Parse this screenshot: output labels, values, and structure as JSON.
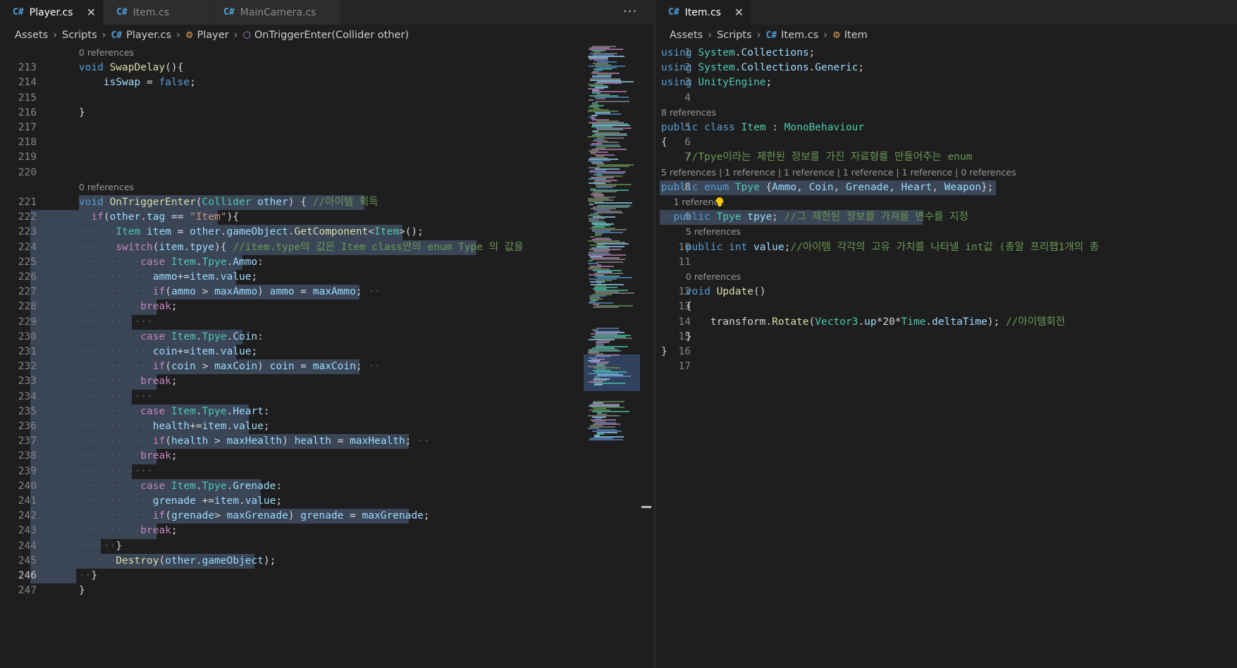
{
  "left_pane": {
    "tabs": [
      {
        "label": "Player.cs",
        "icon": "csharp-icon",
        "active": true,
        "close": "✕"
      },
      {
        "label": "Item.cs",
        "icon": "csharp-icon",
        "active": false
      },
      {
        "label": "MainCamera.cs",
        "icon": "csharp-icon",
        "active": false
      }
    ],
    "more_actions": "···",
    "breadcrumb": {
      "folder1": "Assets",
      "folder2": "Scripts",
      "file": "Player.cs",
      "class": "Player",
      "method": "OnTriggerEnter(Collider other)"
    },
    "lines": [
      {
        "lens": "0 references",
        "n": "213",
        "code": "    void SwapDelay(){"
      },
      {
        "n": "214",
        "code": "        isSwap = false;"
      },
      {
        "n": "215",
        "code": ""
      },
      {
        "n": "216",
        "code": "    }"
      },
      {
        "n": "217",
        "code": ""
      },
      {
        "n": "218",
        "code": ""
      },
      {
        "n": "219",
        "code": ""
      },
      {
        "n": "220",
        "code": ""
      },
      {
        "lens": "0 references",
        "n": "221",
        "code": "    void OnTriggerEnter(Collider other) { //아이템 획득"
      },
      {
        "n": "222",
        "code": "    ··if(other.tag == \"Item\"){"
      },
      {
        "n": "223",
        "code": "    ······Item item = other.gameObject.GetComponent<Item>();"
      },
      {
        "n": "224",
        "code": "    ······switch(item.tpye){ //item.type의 값은 Item class안의 enum Type 의 값을"
      },
      {
        "n": "225",
        "code": "    ··········case Item.Tpye.Ammo:"
      },
      {
        "n": "226",
        "code": "    ············ammo+=item.value;"
      },
      {
        "n": "227",
        "code": "    ············if(ammo > maxAmmo) ammo = maxAmmo; ··"
      },
      {
        "n": "228",
        "code": "    ··········break;"
      },
      {
        "n": "229",
        "code": "    ············"
      },
      {
        "n": "230",
        "code": "    ··········case Item.Tpye.Coin:"
      },
      {
        "n": "231",
        "code": "    ············coin+=item.value;"
      },
      {
        "n": "232",
        "code": "    ············if(coin > maxCoin) coin = maxCoin; ··"
      },
      {
        "n": "233",
        "code": "    ··········break;"
      },
      {
        "n": "234",
        "code": "    ············"
      },
      {
        "n": "235",
        "code": "    ··········case Item.Tpye.Heart:"
      },
      {
        "n": "236",
        "code": "    ············health+=item.value;"
      },
      {
        "n": "237",
        "code": "    ············if(health > maxHealth) health = maxHealth; ··"
      },
      {
        "n": "238",
        "code": "    ··········break;"
      },
      {
        "n": "239",
        "code": "    ············"
      },
      {
        "n": "240",
        "code": "    ··········case Item.Tpye.Grenade:"
      },
      {
        "n": "241",
        "code": "    ············grenade +=item.value;"
      },
      {
        "n": "242",
        "code": "    ············if(grenade> maxGrenade) grenade = maxGrenade;"
      },
      {
        "n": "243",
        "code": "    ··········break;"
      },
      {
        "n": "244",
        "code": "    ······}"
      },
      {
        "n": "245",
        "code": "    ······Destroy(other.gameObject);"
      },
      {
        "n": "246",
        "code": "    ··}"
      },
      {
        "n": "247",
        "code": "    }"
      }
    ]
  },
  "right_pane": {
    "tabs": [
      {
        "label": "Item.cs",
        "icon": "csharp-icon",
        "active": true,
        "close": "✕"
      }
    ],
    "breadcrumb": {
      "folder1": "Assets",
      "folder2": "Scripts",
      "file": "Item.cs",
      "class": "Item"
    },
    "lines": [
      {
        "n": "1",
        "code": "using System.Collections;"
      },
      {
        "n": "2",
        "code": "using System.Collections.Generic;"
      },
      {
        "n": "3",
        "code": "using UnityEngine;"
      },
      {
        "n": "4",
        "code": ""
      },
      {
        "lens": "8 references",
        "n": "5",
        "code": "public class Item : MonoBehaviour"
      },
      {
        "n": "6",
        "code": "{"
      },
      {
        "n": "7",
        "code": "    //Tpye이라는 제한된 정보를 가진 자료형를 만들어주는 enum"
      },
      {
        "lens": "5 references | 1 reference | 1 reference | 1 reference | 1 reference | 0 references",
        "n": "8",
        "code": "public enum Tpye {Ammo, Coin, Grenade, Heart, Weapon};"
      },
      {
        "lens": "1 reference",
        "n": "9",
        "code": "··public Tpye tpye; //그 제한된 정보를 가져올 변수를 지정"
      },
      {
        "lens": "5 references",
        "n": "10",
        "code": "    public int value;//아이템 각각의 고유 가치를 나타낼 int값 (총알 프리팹1개의 총"
      },
      {
        "n": "11",
        "code": ""
      },
      {
        "lens": "0 references",
        "n": "12",
        "code": "    void Update()"
      },
      {
        "n": "13",
        "code": "    {"
      },
      {
        "n": "14",
        "code": "        transform.Rotate(Vector3.up*20*Time.deltaTime); //아이템회전"
      },
      {
        "n": "15",
        "code": "    }"
      },
      {
        "n": "16",
        "code": "}"
      },
      {
        "n": "17",
        "code": ""
      }
    ]
  },
  "colors": {
    "background": "#1e1e1e",
    "selection": "#3a4556",
    "keyword": "#569cd6",
    "control": "#c586c0",
    "type": "#4ec9b0",
    "function": "#dcdcaa",
    "variable": "#9cdcfe",
    "comment": "#6a9955",
    "string": "#ce9178"
  }
}
